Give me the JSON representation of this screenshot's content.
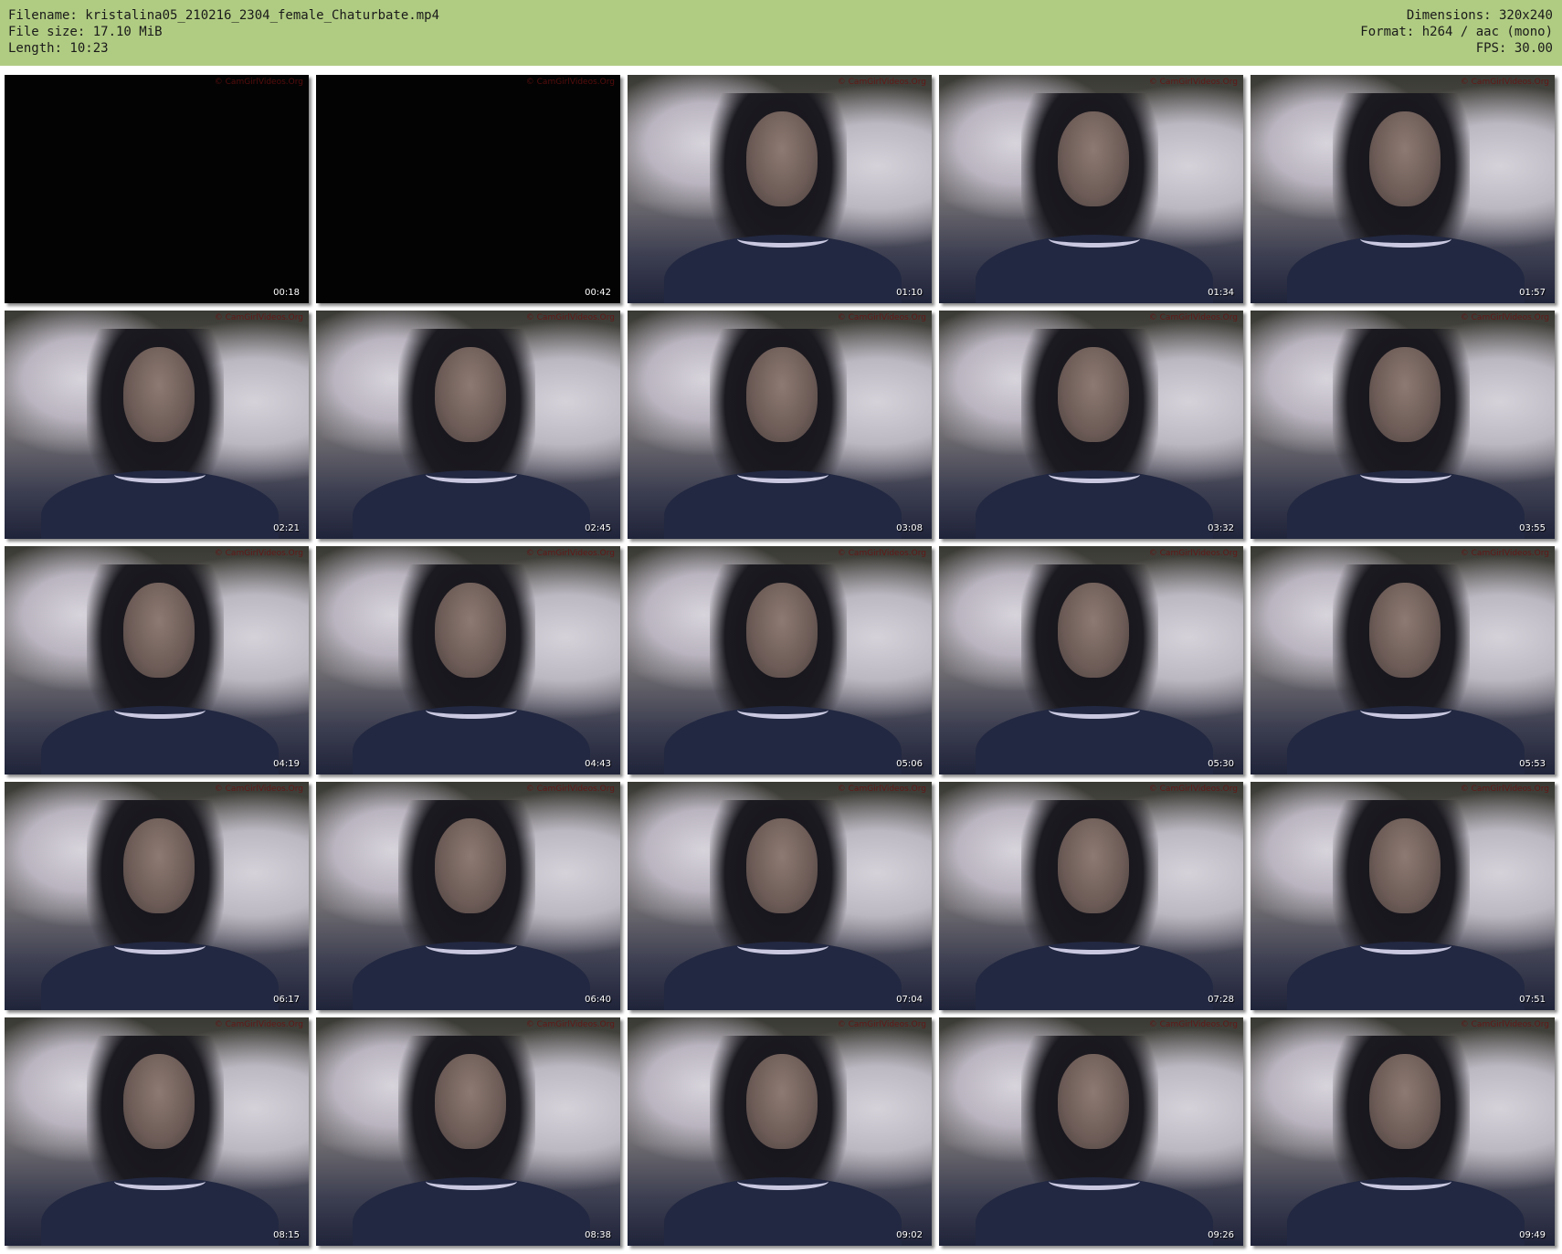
{
  "header": {
    "filename_label": "Filename: kristalina05_210216_2304_female_Chaturbate.mp4",
    "filesize_label": "File size: 17.10 MiB",
    "length_label": "Length: 10:23",
    "dimensions_label": "Dimensions: 320x240",
    "format_label": "Format: h264 / aac (mono)",
    "fps_label": "FPS: 30.00",
    "background_color": "#b0cc82"
  },
  "watermark_text": "© CamGirlVideos.Org",
  "thumbnails": [
    {
      "time": "00:18",
      "scene": "black"
    },
    {
      "time": "00:42",
      "scene": "black"
    },
    {
      "time": "01:10",
      "scene": "webcam"
    },
    {
      "time": "01:34",
      "scene": "webcam"
    },
    {
      "time": "01:57",
      "scene": "webcam"
    },
    {
      "time": "02:21",
      "scene": "webcam"
    },
    {
      "time": "02:45",
      "scene": "webcam"
    },
    {
      "time": "03:08",
      "scene": "webcam"
    },
    {
      "time": "03:32",
      "scene": "webcam"
    },
    {
      "time": "03:55",
      "scene": "webcam"
    },
    {
      "time": "04:19",
      "scene": "webcam"
    },
    {
      "time": "04:43",
      "scene": "webcam"
    },
    {
      "time": "05:06",
      "scene": "webcam"
    },
    {
      "time": "05:30",
      "scene": "webcam"
    },
    {
      "time": "05:53",
      "scene": "webcam"
    },
    {
      "time": "06:17",
      "scene": "webcam"
    },
    {
      "time": "06:40",
      "scene": "webcam"
    },
    {
      "time": "07:04",
      "scene": "webcam"
    },
    {
      "time": "07:28",
      "scene": "webcam"
    },
    {
      "time": "07:51",
      "scene": "webcam"
    },
    {
      "time": "08:15",
      "scene": "webcam"
    },
    {
      "time": "08:38",
      "scene": "webcam"
    },
    {
      "time": "09:02",
      "scene": "webcam"
    },
    {
      "time": "09:26",
      "scene": "webcam"
    },
    {
      "time": "09:49",
      "scene": "webcam"
    }
  ]
}
